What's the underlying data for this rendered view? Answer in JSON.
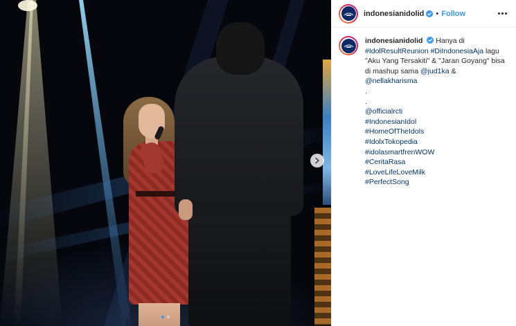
{
  "post": {
    "username": "indonesianidolid",
    "follow_label": "Follow",
    "separator": "•",
    "caption": {
      "t1": "Hanya di",
      "tag_reunion": "#IdolResultReunion",
      "tag_diindonesia": "#DiIndonesiaAja",
      "t2": "lagu \"Aku Yang Tersakiti\" & \"Jaran Goyang\" bisa di mashup sama",
      "mention_1": "@jud1ka",
      "t3": "&",
      "mention_2": "@nellakharisma",
      "dot1": ".",
      "dot2": ".",
      "mention_rcti": "@officialrcti",
      "tags": [
        "#IndonesianIdol",
        "#HomeOfTheIdols",
        "#IdolxTokopedia",
        "#idolasmartfrenWOW",
        "#CeritaRasa",
        "#LoveLifeLoveMilk",
        "#PerfectSong"
      ]
    },
    "carousel": {
      "count": 2,
      "active": 1
    },
    "colors": {
      "link": "#003569",
      "follow": "#3897f0",
      "verified": "#3897f0",
      "avatar_bg": "#0c2a66"
    }
  }
}
